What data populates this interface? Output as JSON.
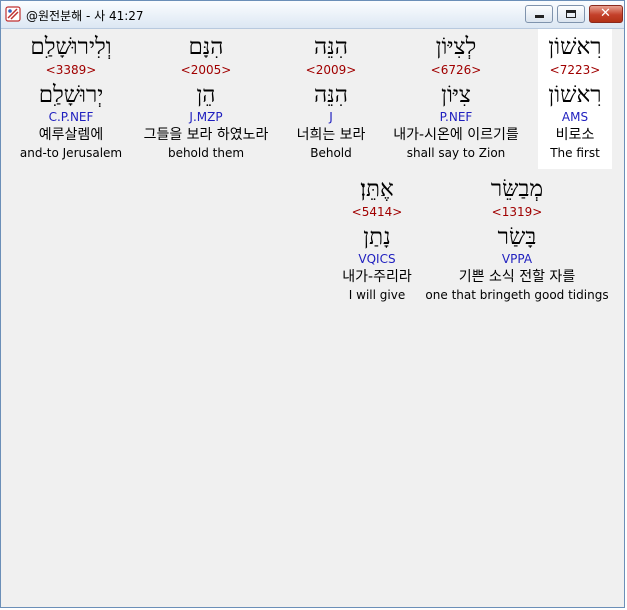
{
  "window": {
    "title": "@원전분해 - 사 41:27",
    "close_glyph": "✕"
  },
  "words": [
    {
      "id": "w1",
      "hebrew": "רִאשׁוֹן",
      "strong": "<7223>",
      "lemma": "רִאשׁוֹן",
      "morph": "AMS",
      "korean": "비로소",
      "english": "The first",
      "selected": true
    },
    {
      "id": "w2",
      "hebrew": "לְצִיּוֹן",
      "strong": "<6726>",
      "lemma": "צִיּוֹן",
      "morph": "P.NEF",
      "korean": "내가-시온에 이르기를",
      "english": "shall say to Zion"
    },
    {
      "id": "w3",
      "hebrew": "הִנֵּה",
      "strong": "<2009>",
      "lemma": "הִנֵּה",
      "morph": "J",
      "korean": "너희는 보라",
      "english": "Behold"
    },
    {
      "id": "w4",
      "hebrew": "הִנָּם",
      "strong": "<2005>",
      "lemma": "הֵן",
      "morph": "J.MZP",
      "korean": "그들을 보라 하였노라",
      "english": "behold them"
    },
    {
      "id": "w5",
      "hebrew": "וְלִירוּשָׁלִַם",
      "strong": "<3389>",
      "lemma": "יְרוּשָׁלִַם",
      "morph": "C.P.NEF",
      "korean": "예루살렘에",
      "english": "and-to Jerusalem"
    },
    {
      "id": "w6",
      "hebrew": "מְבַשֵּׂר",
      "strong": "<1319>",
      "lemma": "בָּשַׂר",
      "morph": "VPPA",
      "korean": "기쁜 소식 전할 자를",
      "english": "one that bringeth good tidings"
    },
    {
      "id": "w7",
      "hebrew": "אֶתֵּן׃",
      "strong": "<5414>",
      "lemma": "נָתַן",
      "morph": "VQICS",
      "korean": "내가-주리라",
      "english": "I will give"
    }
  ]
}
